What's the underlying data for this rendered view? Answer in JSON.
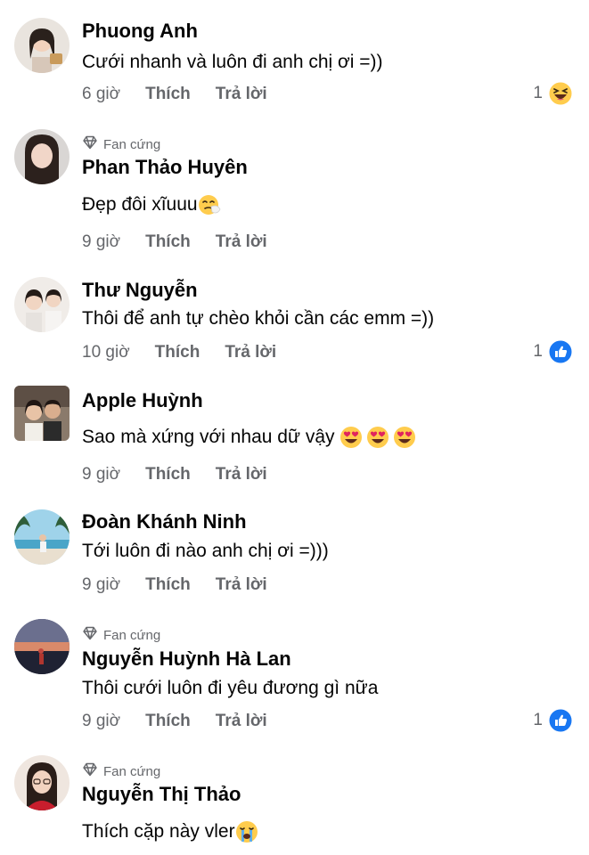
{
  "comments": [
    {
      "name": "Phuong Anh",
      "badge": "",
      "text": "Cưới nhanh và luôn đi anh chị ơi =))",
      "time": "6 giờ",
      "like": "Thích",
      "reply": "Trả lời",
      "reaction_count": "1",
      "reaction_icon": "laugh-reaction-icon"
    },
    {
      "name": "Phan Thảo Huyên",
      "badge": "Fan cứng",
      "text": "Đẹp đôi xĩuuu",
      "text_emoji": "sneezing-face-icon",
      "time": "9 giờ",
      "like": "Thích",
      "reply": "Trả lời"
    },
    {
      "name": "Thư Nguyễn",
      "badge": "",
      "text": "Thôi để anh tự chèo khỏi cần các emm =))",
      "time": "10 giờ",
      "like": "Thích",
      "reply": "Trả lời",
      "reaction_count": "1",
      "reaction_icon": "like-reaction-icon"
    },
    {
      "name": "Apple Huỳnh",
      "badge": "",
      "text": "Sao mà xứng với nhau dữ vậy ",
      "text_emoji": "heart-eyes-icon",
      "time": "9 giờ",
      "like": "Thích",
      "reply": "Trả lời"
    },
    {
      "name": "Đoàn Khánh Ninh",
      "badge": "",
      "text": "Tới luôn đi nào anh chị ơi =)))",
      "time": "9 giờ",
      "like": "Thích",
      "reply": "Trả lời"
    },
    {
      "name": "Nguyễn Huỳnh Hà Lan",
      "badge": "Fan cứng",
      "text": "Thôi cưới luôn đi yêu đương gì nữa",
      "time": "9 giờ",
      "like": "Thích",
      "reply": "Trả lời",
      "reaction_count": "1",
      "reaction_icon": "like-reaction-icon"
    },
    {
      "name": "Nguyễn Thị Thảo",
      "badge": "Fan cứng",
      "text": "Thích cặp này vler",
      "text_emoji": "crying-face-icon",
      "time": "",
      "like": "",
      "reply": ""
    }
  ],
  "colors": {
    "text": "#050505",
    "meta": "#65676b",
    "like_blue": "#1877f2",
    "emoji_yellow": "#ffcc4d"
  }
}
